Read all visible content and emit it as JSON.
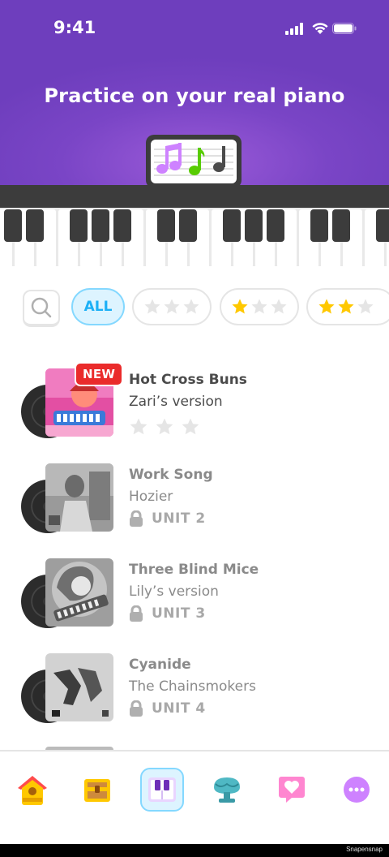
{
  "status_bar": {
    "time": "9:41"
  },
  "header": {
    "title": "Practice on your real piano"
  },
  "filters": {
    "all_label": "ALL"
  },
  "songs": [
    {
      "title": "Hot Cross Buns",
      "artist": "Zari’s version",
      "badge": "NEW",
      "stars_earned": 0,
      "locked": false
    },
    {
      "title": "Work Song",
      "artist": "Hozier",
      "unit": "UNIT 2",
      "locked": true
    },
    {
      "title": "Three Blind Mice",
      "artist": "Lily’s version",
      "unit": "UNIT 3",
      "locked": true
    },
    {
      "title": "Cyanide",
      "artist": "The Chainsmokers",
      "unit": "UNIT 4",
      "locked": true
    }
  ],
  "nav": [
    "home-icon",
    "treasure-chest-icon",
    "piano-icon",
    "shop-icon",
    "heart-icon",
    "more-icon"
  ],
  "footer": {
    "watermark": "Snapensnap"
  },
  "colors": {
    "header_purple": "#7a45c6",
    "accent_blue": "#1cb0f6",
    "new_red": "#ea2b2b",
    "star_gold": "#ffc800"
  }
}
